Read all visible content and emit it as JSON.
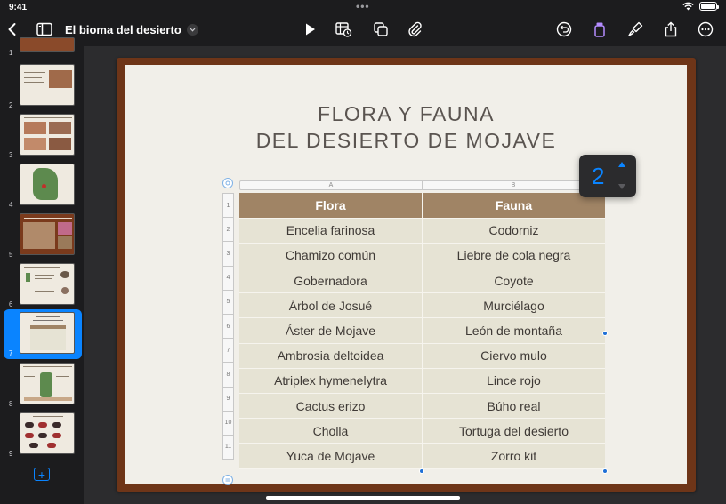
{
  "status": {
    "time": "9:41",
    "dots": "•••"
  },
  "toolbar": {
    "title": "El bioma del desierto"
  },
  "sidebar": {
    "slides": [
      {
        "number": "1"
      },
      {
        "number": "2"
      },
      {
        "number": "3"
      },
      {
        "number": "4"
      },
      {
        "number": "5"
      },
      {
        "number": "6"
      },
      {
        "number": "7"
      },
      {
        "number": "8"
      },
      {
        "number": "9"
      }
    ]
  },
  "slide": {
    "title_line1": "FLORA Y FAUNA",
    "title_line2": "DEL DESIERTO DE MOJAVE",
    "columns": [
      "A",
      "B"
    ],
    "row_numbers": [
      "1",
      "2",
      "3",
      "4",
      "5",
      "6",
      "7",
      "8",
      "9",
      "10",
      "11"
    ],
    "header": [
      "Flora",
      "Fauna"
    ],
    "rows": [
      [
        "Encelia farinosa",
        "Codorniz"
      ],
      [
        "Chamizo común",
        "Liebre de cola negra"
      ],
      [
        "Gobernadora",
        "Coyote"
      ],
      [
        "Árbol de Josué",
        "Murciélago"
      ],
      [
        "Áster de Mojave",
        "León de montaña"
      ],
      [
        "Ambrosia deltoidea",
        "Ciervo mulo"
      ],
      [
        "Atriplex hymenelytra",
        "Lince rojo"
      ],
      [
        "Cactus erizo",
        "Búho real"
      ],
      [
        "Cholla",
        "Tortuga del desierto"
      ],
      [
        "Yuca de Mojave",
        "Zorro kit"
      ]
    ]
  },
  "stepper": {
    "value": "2"
  },
  "colors": {
    "accent": "#0a84ff",
    "table_header": "#a08465",
    "table_body": "#e6e3d4",
    "frame": "#6e3518"
  }
}
